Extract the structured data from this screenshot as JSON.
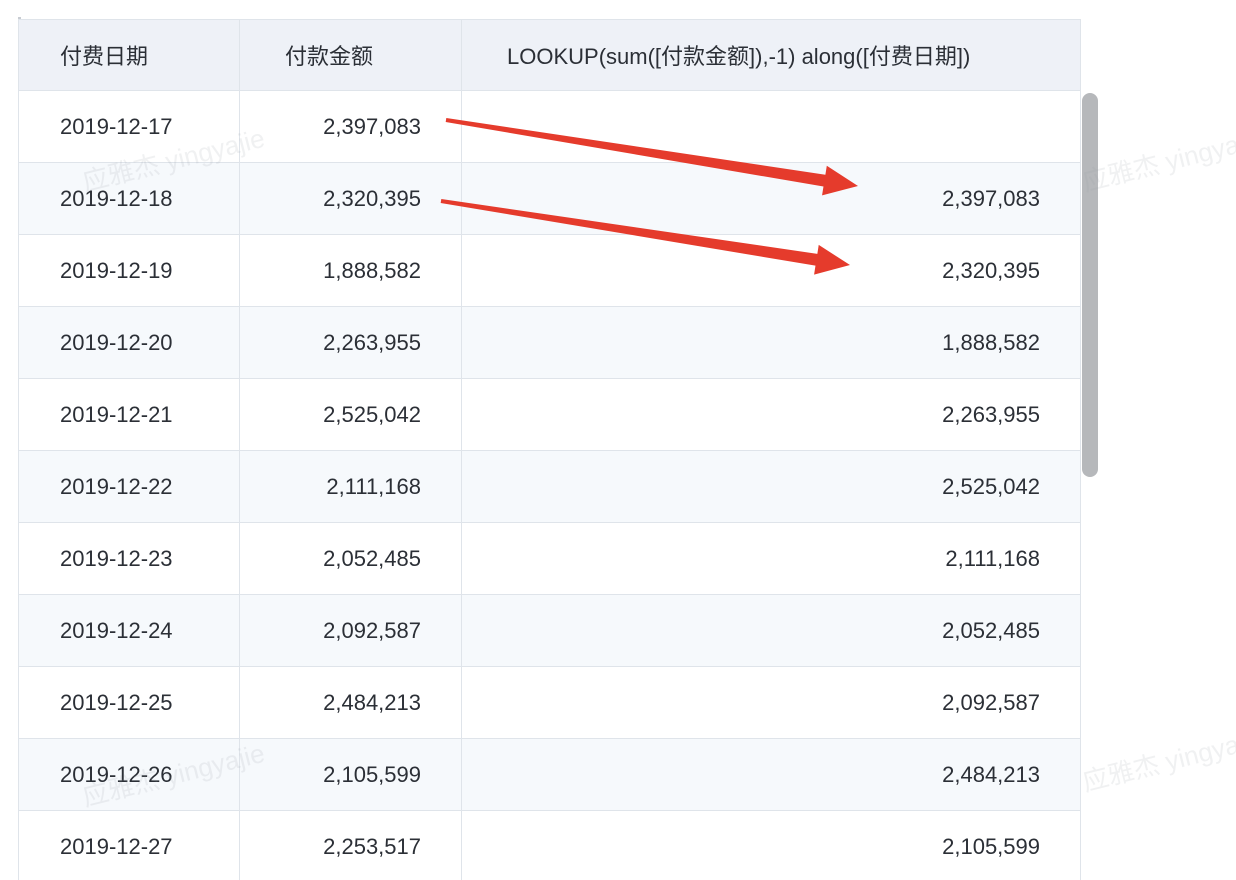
{
  "table": {
    "columns": [
      "付费日期",
      "付款金额",
      "LOOKUP(sum([付款金额]),-1) along([付费日期])"
    ],
    "rows": [
      {
        "date": "2019-12-17",
        "amount": "2,397,083",
        "lookup": ""
      },
      {
        "date": "2019-12-18",
        "amount": "2,320,395",
        "lookup": "2,397,083"
      },
      {
        "date": "2019-12-19",
        "amount": "1,888,582",
        "lookup": "2,320,395"
      },
      {
        "date": "2019-12-20",
        "amount": "2,263,955",
        "lookup": "1,888,582"
      },
      {
        "date": "2019-12-21",
        "amount": "2,525,042",
        "lookup": "2,263,955"
      },
      {
        "date": "2019-12-22",
        "amount": "2,111,168",
        "lookup": "2,525,042"
      },
      {
        "date": "2019-12-23",
        "amount": "2,052,485",
        "lookup": "2,111,168"
      },
      {
        "date": "2019-12-24",
        "amount": "2,092,587",
        "lookup": "2,052,485"
      },
      {
        "date": "2019-12-25",
        "amount": "2,484,213",
        "lookup": "2,092,587"
      },
      {
        "date": "2019-12-26",
        "amount": "2,105,599",
        "lookup": "2,484,213"
      },
      {
        "date": "2019-12-27",
        "amount": "2,253,517",
        "lookup": "2,105,599"
      }
    ]
  },
  "watermark": {
    "text": "应雅杰 yingyajie"
  },
  "colors": {
    "arrow": "#e53b2c",
    "header_bg": "#eef1f7",
    "alt_row_bg": "#f6f9fc",
    "grid": "#dfe4ea",
    "scrollbar": "#b6b8bb"
  }
}
